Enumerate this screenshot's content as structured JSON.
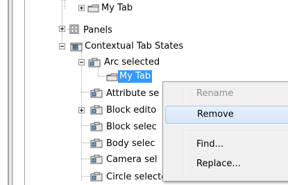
{
  "tree": {
    "items": [
      {
        "label": "My Tab",
        "icon": "tab-icon",
        "expander": "plus"
      },
      {
        "label": "Panels",
        "icon": "panels-icon",
        "expander": "plus"
      },
      {
        "label": "Contextual Tab States",
        "icon": "contextual-states-icon",
        "expander": "minus"
      },
      {
        "label": "Arc selected",
        "icon": "state-icon",
        "expander": "minus"
      },
      {
        "label": "My Tab",
        "icon": "tab-icon",
        "selected": true
      },
      {
        "label": "Attribute se",
        "icon": "state-icon"
      },
      {
        "label": "Block edito",
        "icon": "state-icon",
        "expander": "plus"
      },
      {
        "label": "Block selec",
        "icon": "state-icon"
      },
      {
        "label": "Body selec",
        "icon": "state-icon"
      },
      {
        "label": "Camera sel",
        "icon": "state-icon"
      },
      {
        "label": "Circle selected",
        "icon": "state-icon"
      }
    ]
  },
  "context_menu": {
    "items": [
      {
        "label": "Rename",
        "enabled": false
      },
      {
        "label": "Remove",
        "enabled": true,
        "highlighted": true
      },
      {
        "label": "Find...",
        "enabled": true
      },
      {
        "label": "Replace...",
        "enabled": true
      }
    ]
  },
  "colors": {
    "selection": "#3399ff",
    "menu_background": "#f0f0f0",
    "menu_highlight": "#d6e6fb",
    "disabled_text": "#8d8d8d"
  }
}
